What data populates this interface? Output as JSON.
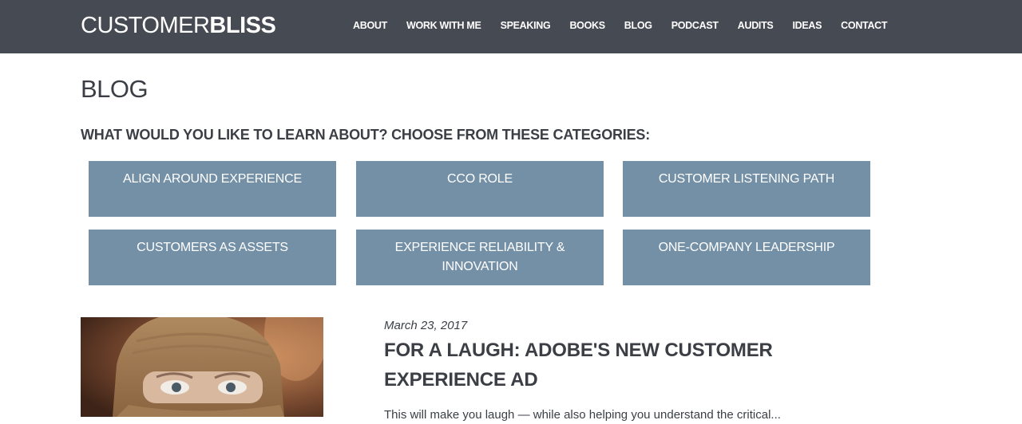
{
  "header": {
    "logo_light": "CUSTOMER",
    "logo_bold": "BLISS",
    "nav": [
      {
        "label": "ABOUT"
      },
      {
        "label": "WORK WITH ME"
      },
      {
        "label": "SPEAKING"
      },
      {
        "label": "BOOKS"
      },
      {
        "label": "BLOG"
      },
      {
        "label": "PODCAST"
      },
      {
        "label": "AUDITS"
      },
      {
        "label": "IDEAS"
      },
      {
        "label": "CONTACT"
      }
    ]
  },
  "main": {
    "title": "BLOG",
    "categories_heading": "WHAT WOULD YOU LIKE TO LEARN ABOUT? CHOOSE FROM THESE CATEGORIES:",
    "categories": [
      {
        "label": "ALIGN AROUND EXPERIENCE"
      },
      {
        "label": "CCO ROLE"
      },
      {
        "label": "CUSTOMER LISTENING PATH"
      },
      {
        "label": "CUSTOMERS AS ASSETS"
      },
      {
        "label": "EXPERIENCE RELIABILITY & INNOVATION"
      },
      {
        "label": "ONE-COMPANY LEADERSHIP"
      }
    ],
    "post": {
      "date": "March 23, 2017",
      "title": "FOR A LAUGH: ADOBE'S NEW CUSTOMER EXPERIENCE AD",
      "excerpt": "This will make you laugh — while also helping you understand the critical..."
    }
  },
  "colors": {
    "header_bg": "#464a52",
    "category_bg": "#7490a6",
    "text": "#3b3f45"
  }
}
